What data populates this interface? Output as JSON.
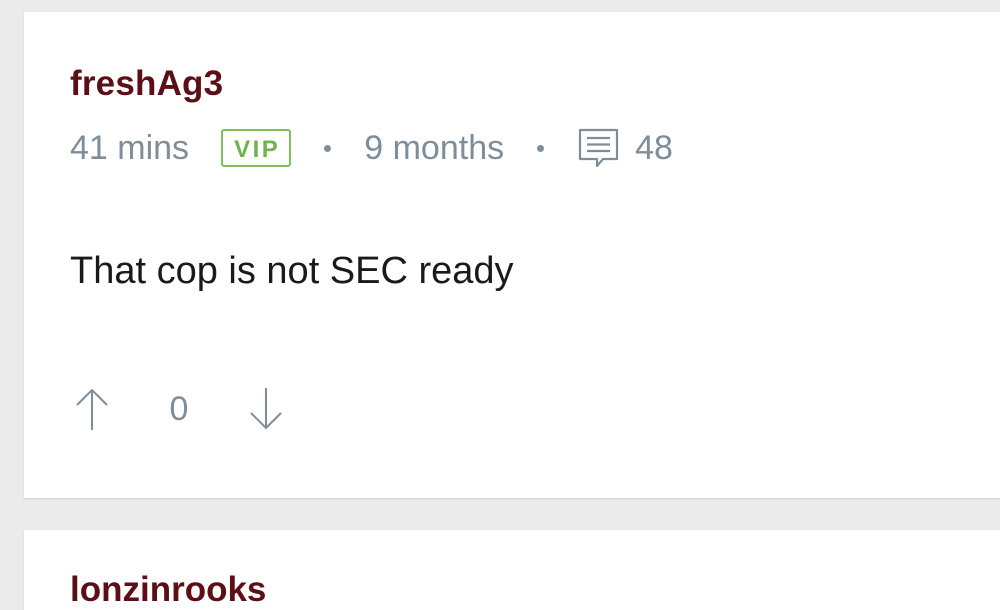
{
  "comment": {
    "username": "freshAg3",
    "time_posted": "41 mins",
    "badge": "VIP",
    "member_for": "9 months",
    "comment_count": "48",
    "text": "That cop is not SEC ready",
    "vote_count": "0",
    "icons": {
      "comments": "comment-bubble-icon",
      "upvote": "arrow-up-icon",
      "downvote": "arrow-down-icon"
    }
  },
  "next_comment": {
    "username": "lonzinrooks"
  },
  "colors": {
    "username": "#5c0f14",
    "meta": "#7f8d99",
    "vip": "#6db450",
    "text": "#1a1a1a",
    "background": "#ebebeb",
    "card": "#ffffff"
  }
}
